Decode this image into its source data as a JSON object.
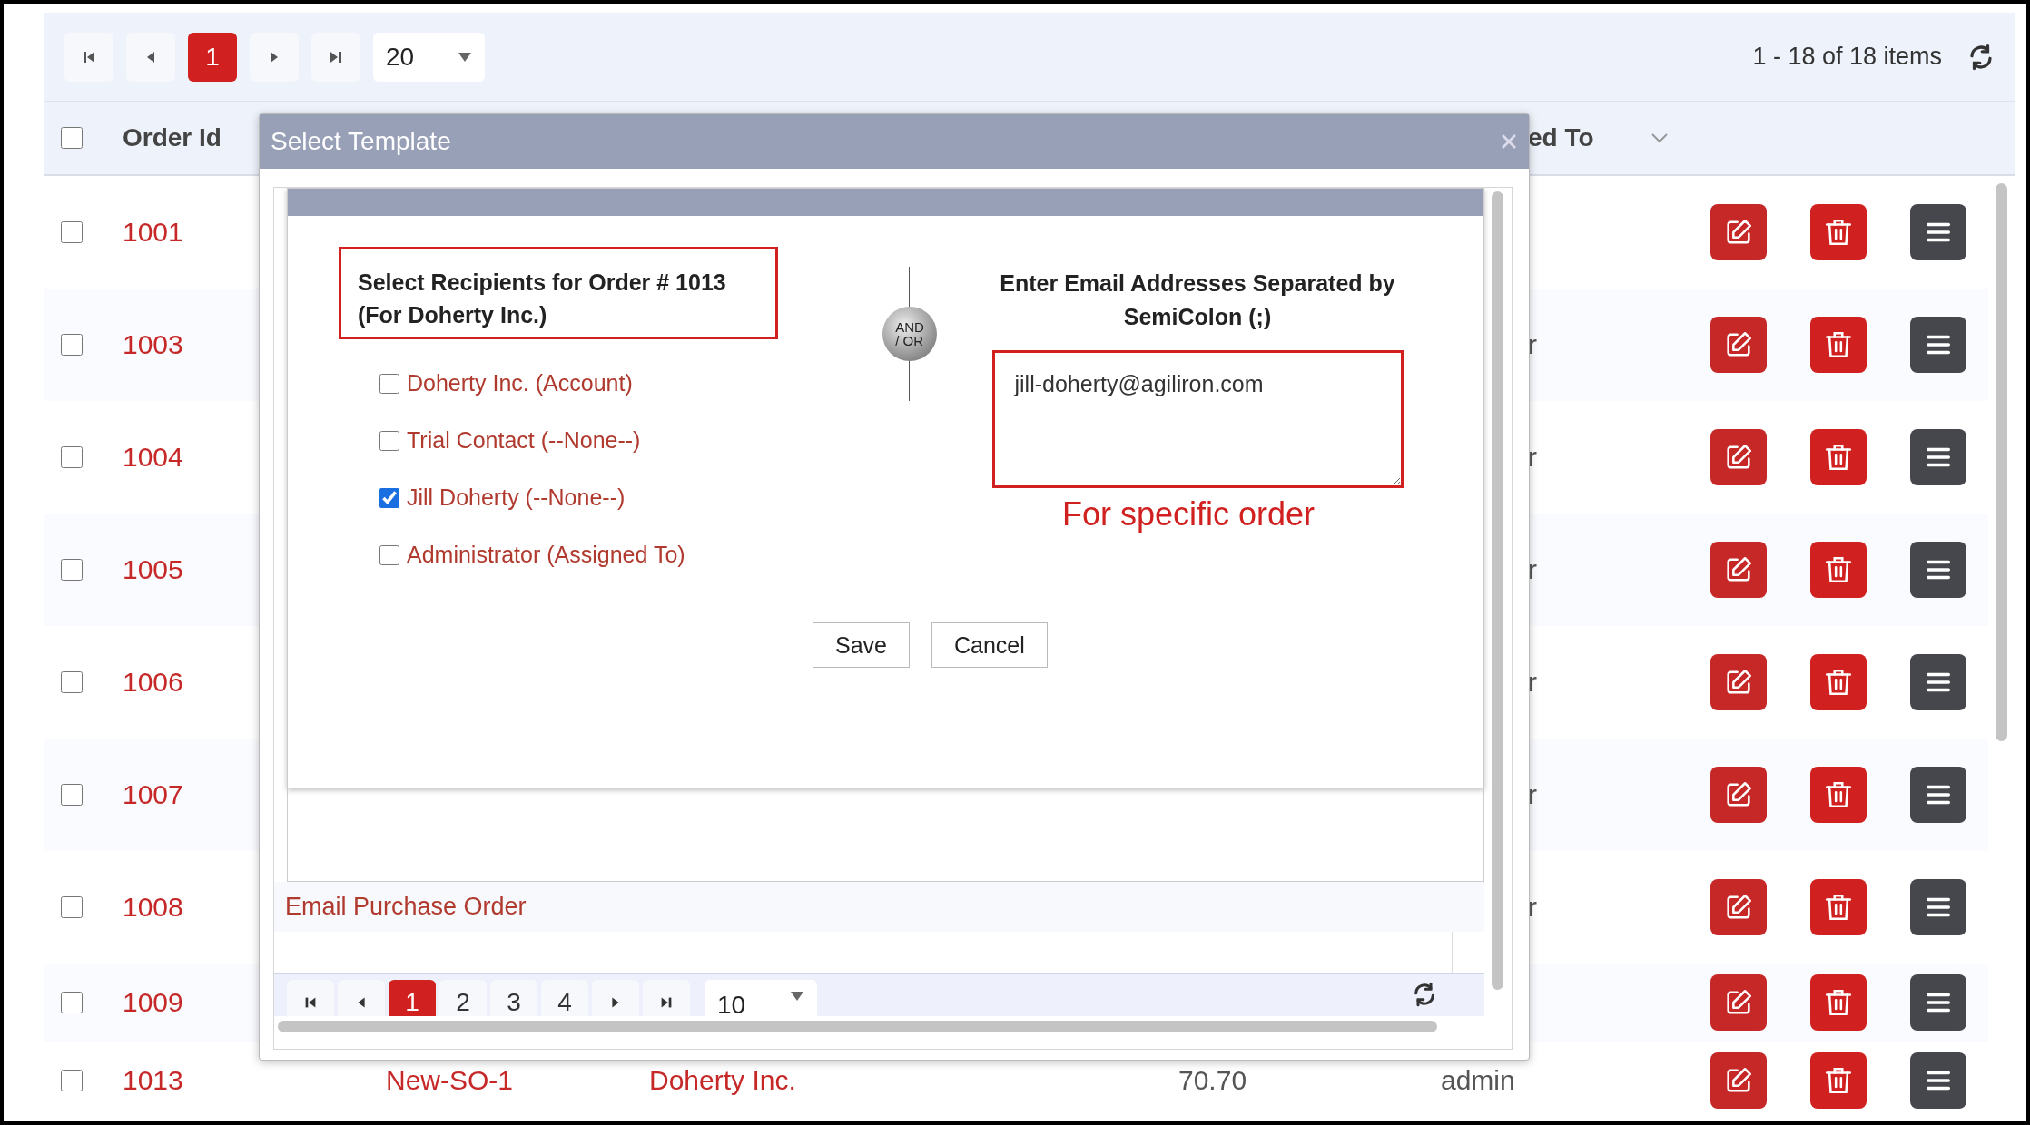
{
  "pager": {
    "pages": [
      {
        "label": "1",
        "selected": true
      }
    ],
    "page_size": "20",
    "summary": "1 - 18 of 18 items"
  },
  "table": {
    "header": {
      "checked": false,
      "column_2": "Order Id",
      "column_6": "ed To"
    },
    "rows": [
      {
        "kind": "partly_hidden",
        "checked": false,
        "column_2": "1001"
      },
      {
        "kind": "partly_hidden",
        "checked": false,
        "column_2": "1003",
        "column_6": "r"
      },
      {
        "kind": "partly_hidden",
        "checked": false,
        "column_2": "1004",
        "column_6": "r"
      },
      {
        "kind": "partly_hidden",
        "checked": false,
        "column_2": "1005",
        "column_6": "r"
      },
      {
        "kind": "partly_hidden",
        "checked": false,
        "column_2": "1006",
        "column_6": "r"
      },
      {
        "kind": "partly_hidden",
        "checked": false,
        "column_2": "1007",
        "column_6": "r"
      },
      {
        "kind": "partly_hidden",
        "checked": false,
        "column_2": "1008",
        "column_6": "r"
      },
      {
        "kind": "partly_hidden",
        "checked": false,
        "column_2": "1009"
      },
      {
        "kind": "full",
        "checked": false,
        "column_2": "1013",
        "column_3": "New-SO-1",
        "column_4": "Doherty Inc.",
        "column_5": "70.70",
        "column_6": "admin"
      }
    ]
  },
  "dialog": {
    "title": "Select Template",
    "recipients_heading": [
      "Select Recipients for Order # 1013",
      "(For Doherty Inc.)"
    ],
    "recipients": [
      {
        "label": "Doherty Inc. (Account)",
        "checked": false
      },
      {
        "label": "Trial Contact (--None--)",
        "checked": false
      },
      {
        "label": "Jill Doherty (--None--)",
        "checked": true
      },
      {
        "label": "Administrator (Assigned To)",
        "checked": false
      }
    ],
    "or_badge": [
      "AND",
      "/ OR"
    ],
    "email_heading": [
      "Enter Email Addresses Separated by",
      "SemiColon (;)"
    ],
    "email_value": "jill-doherty@agiliron.com",
    "note": "For specific order",
    "buttons": [
      "Save",
      "Cancel"
    ],
    "templates": [
      {
        "name": "Email Purchase Order"
      }
    ],
    "pager": {
      "pages": [
        {
          "label": "1",
          "selected": true
        },
        {
          "label": "2",
          "selected": false
        },
        {
          "label": "3",
          "selected": false
        },
        {
          "label": "4",
          "selected": false
        }
      ],
      "page_size": "10"
    }
  }
}
